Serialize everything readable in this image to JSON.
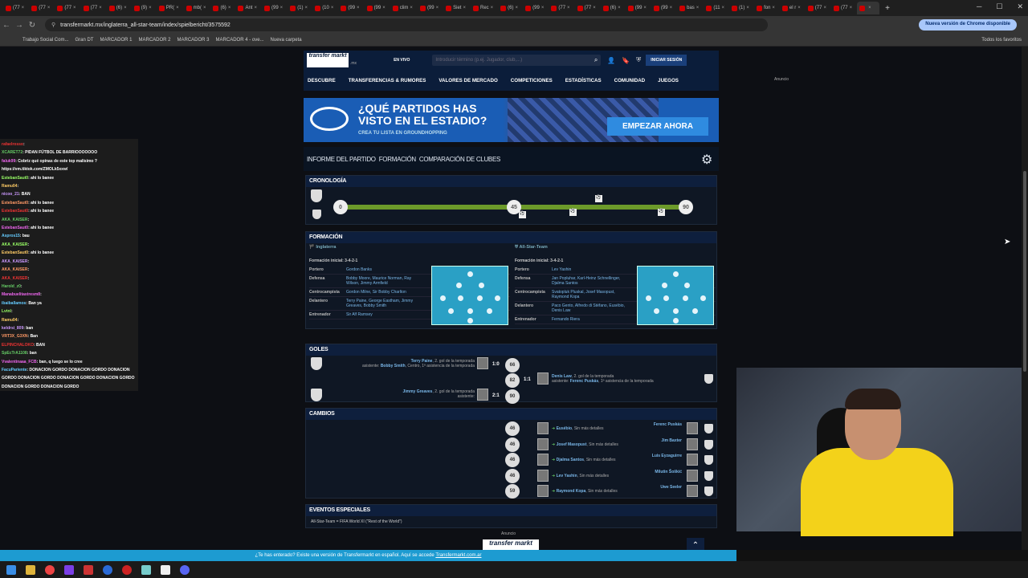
{
  "browser": {
    "tabs": [
      "(77",
      "(77",
      "(77",
      "(77",
      "(6)",
      "(9)",
      "PR(",
      "mb(",
      "(6)",
      "Ant",
      "(99",
      "(1)",
      "(10",
      "(99",
      "(99",
      "clim",
      "(99",
      "Siet",
      "Rec",
      "(6)",
      "(99",
      "(77",
      "(77",
      "(6)",
      "(99",
      "(99",
      "bas",
      "(11",
      "(1)",
      "fon",
      "el r",
      "(77",
      "(77",
      ""
    ],
    "url": "transfermarkt.mx/inglaterra_all-star-team/index/spielbericht/3575592",
    "update_label": "Nueva versión de Chrome disponible",
    "bookmarks": [
      "Trabajo Social Com...",
      "Gran DT",
      "MARCADOR 1",
      "MARCADOR 2",
      "MARCADOR 3",
      "MARCADOR 4 - ove...",
      "Nueva carpeta"
    ],
    "all_bookmarks": "Todos los favoritos"
  },
  "site": {
    "logo": "transfer markt",
    "logo_suffix": ".mx",
    "live": "EN VIVO",
    "search_placeholder": "Introducir término (p.ej. Jugador, club,...)",
    "login": "INICIAR SESIÓN",
    "nav": [
      "DESCUBRE",
      "TRANSFERENCIAS & RUMORES",
      "VALORES DE MERCADO",
      "COMPETICIONES",
      "ESTADÍSTICAS",
      "COMUNIDAD",
      "JUEGOS"
    ],
    "ad_label": "Anuncio"
  },
  "banner": {
    "headline": "¿QUÉ PARTIDOS HAS VISTO EN EL ESTADIO?",
    "sub": "CREA TU LISTA EN GROUNDHOPPING",
    "cta": "EMPEZAR AHORA"
  },
  "subtabs": [
    "INFORME DEL PARTIDO",
    "FORMACIÓN",
    "COMPARACIÓN DE CLUBES"
  ],
  "sections": {
    "timeline": "CRONOLOGÍA",
    "formation": "FORMACIÓN",
    "goals": "GOLES",
    "changes": "CAMBIOS",
    "special": "EVENTOS ESPECIALES"
  },
  "timeline": {
    "start": "0",
    "half": "45",
    "end": "90"
  },
  "formation": {
    "home": {
      "team": "Inglaterra",
      "system": "Formación inicial: 3-4-2-1",
      "rows": [
        {
          "k": "Portero",
          "v": "Gordon Banks"
        },
        {
          "k": "Defensa",
          "v": "Bobby Moore, Maurice Norman, Ray Wilson, Jimmy Armfield"
        },
        {
          "k": "Centrocampista",
          "v": "Gordon Milne, Sir Bobby Charlton"
        },
        {
          "k": "Delantero",
          "v": "Terry Paine, George Eastham, Jimmy Greaves, Bobby Smith"
        },
        {
          "k": "Entrenador",
          "v": "Sir Alf Ramsey"
        }
      ]
    },
    "away": {
      "team": "All-Star-Team",
      "system": "Formación inicial: 3-4-2-1",
      "rows": [
        {
          "k": "Portero",
          "v": "Lev Yashin"
        },
        {
          "k": "Defensa",
          "v": "Jan Popluhar, Karl-Heinz Schnellinger, Djalma Santos"
        },
        {
          "k": "Centrocampista",
          "v": "Svatopluk Pluskal, Josef Masopust, Raymond Kopa"
        },
        {
          "k": "Delantero",
          "v": "Paco Gento, Alfredo di Stéfano, Eusébio, Denis Law"
        },
        {
          "k": "Entrenador",
          "v": "Fernando Riera"
        }
      ]
    }
  },
  "goals": [
    {
      "player": "Terry Paine",
      "desc": ", 2. gol de la temporada",
      "assist_label": "asistente:",
      "assist": "Bobby Smith",
      "assist_desc": ", Centro, 1ª asistencia de la temporada",
      "score": "1:0",
      "minute": "66",
      "side": "home"
    },
    {
      "player": "Denis Law",
      "desc": ", 2. gol de la temporada",
      "assist_label": "asistente:",
      "assist": "Ferenc Puskás",
      "assist_desc": ", 1ª asistencia de la temporada",
      "score": "1:1",
      "minute": "82",
      "side": "away"
    },
    {
      "player": "Jimmy Greaves",
      "desc": ", 2. gol de la temporada",
      "assist_label": "asistente:",
      "assist": "",
      "assist_desc": "",
      "score": "2:1",
      "minute": "90",
      "side": "home"
    }
  ],
  "changes": [
    {
      "minute": "46",
      "in": "Eusébio",
      "in_desc": ", Sin más detalles",
      "out": "Ferenc Puskás"
    },
    {
      "minute": "46",
      "in": "Josef Masopust",
      "in_desc": ", Sin más detalles",
      "out": "Jim Baxter"
    },
    {
      "minute": "46",
      "in": "Djalma Santos",
      "in_desc": ", Sin más detalles",
      "out": "Luis Eyzaguirre"
    },
    {
      "minute": "46",
      "in": "Lev Yashin",
      "in_desc": ", Sin más detalles",
      "out": "Milutin Šoškić"
    },
    {
      "minute": "59",
      "in": "Raymond Kopa",
      "in_desc": ", Sin más detalles",
      "out": "Uwe Seeler"
    }
  ],
  "special": "All-Star-Team = FIFA World XI (\"Rest of the World\")",
  "chat": [
    {
      "u": "rafaelrosso",
      "t": ":"
    },
    {
      "u": "XCARET72",
      "t": ": PIDAN FÚTBOL DE BARRIOOOOOOO"
    },
    {
      "u": "faluk99",
      "t": ": Cobriz qué opinas de este top malísimo ?"
    },
    {
      "u": "",
      "t": "https://vm.tiktok.com/ZMOLk5xxw/"
    },
    {
      "u": "EstebanSaut0",
      "t": ": ahi lo banee"
    },
    {
      "u": "Ramu04",
      "t": ":"
    },
    {
      "u": "nicoo_21",
      "t": ": BAN"
    },
    {
      "u": "EstebanSaut0",
      "t": ": ahi lo banee"
    },
    {
      "u": "EstebanSaut0",
      "t": ": ahi lo banee"
    },
    {
      "u": "AKA_KAISER",
      "t": ":"
    },
    {
      "u": "EstebanSaut0",
      "t": ": ahi lo banee"
    },
    {
      "u": "Aspros15",
      "t": ": bau"
    },
    {
      "u": "AKA_KAISER",
      "t": ":"
    },
    {
      "u": "EstebanSaut0",
      "t": ": ahi lo banee"
    },
    {
      "u": "AKA_KAISER",
      "t": ":"
    },
    {
      "u": "AKA_KAISER",
      "t": ":"
    },
    {
      "u": "AKA_KAISER",
      "t": ":"
    },
    {
      "u": "Harold_z0",
      "t": ":"
    },
    {
      "u": "Manabuelitastresm8",
      "t": ":"
    },
    {
      "u": "ibaiballamos",
      "t": ": Ban ya"
    },
    {
      "u": "Lvtnl",
      "t": ":"
    },
    {
      "u": "Ramu04",
      "t": ":"
    },
    {
      "u": "keldrsi_809",
      "t": ": ban"
    },
    {
      "u": "VRT3X_G3XN",
      "t": ": Ban"
    },
    {
      "u": "ELPINCHALOKO",
      "t": ": BAN"
    },
    {
      "u": "SpEcTrA1108",
      "t": ": ban"
    },
    {
      "u": "Vvalentinaaa_FCB",
      "t": ": ban, q luego se lo cree"
    },
    {
      "u": "FacuPariente",
      "t": ": DONACION GORDO DONACION GORDO DONACION GORDO DONACION GORDO DONACION GORDO DONACION GORDO DONACION GORDO DONACION GORDO"
    }
  ],
  "promo": {
    "text": "¿Te has enterado? Existe una versión de Transfermarkt en español. Aquí se accede",
    "link": "Transfermarkt.com.ar"
  },
  "colors": {
    "accent": "#1a3f7a",
    "timeline": "#6c9a2a",
    "pitch": "#2aa0c5",
    "link": "#7ab7e8"
  }
}
